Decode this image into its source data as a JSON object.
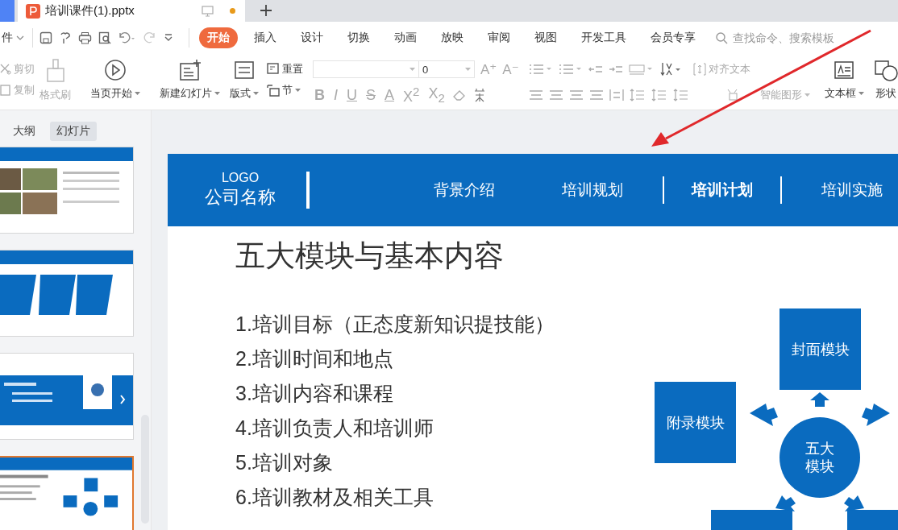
{
  "document_tab": {
    "title": "培训课件(1).pptx",
    "modified": true
  },
  "quick_access": {
    "file_menu": "件"
  },
  "menu_tabs": [
    {
      "label": "开始",
      "selected": true
    },
    {
      "label": "插入",
      "selected": false
    },
    {
      "label": "设计",
      "selected": false
    },
    {
      "label": "切换",
      "selected": false
    },
    {
      "label": "动画",
      "selected": false
    },
    {
      "label": "放映",
      "selected": false
    },
    {
      "label": "审阅",
      "selected": false
    },
    {
      "label": "视图",
      "selected": false
    },
    {
      "label": "开发工具",
      "selected": false
    },
    {
      "label": "会员专享",
      "selected": false
    }
  ],
  "search": {
    "placeholder": "查找命令、搜索模板"
  },
  "ribbon": {
    "cut": {
      "label": "剪切",
      "disabled": true
    },
    "copy": {
      "label": "复制",
      "disabled": true
    },
    "format_painter": {
      "label": "格式刷",
      "disabled": true
    },
    "play_from_current": "当页开始",
    "new_slide": "新建幻灯片",
    "layout": "版式",
    "reset": "重置",
    "section": "节",
    "font_size": "0",
    "font_grow": "A⁺",
    "font_shrink": "A⁻",
    "format_buttons": [
      "B",
      "I",
      "U",
      "S",
      "A",
      "X$^{2}$",
      "X$_{2}$"
    ],
    "align_text": {
      "label": "对齐文本",
      "disabled": true
    },
    "smart_art": {
      "label": "智能图形",
      "disabled": true
    },
    "text_box": "文本框",
    "shapes": "形状"
  },
  "panel": {
    "tabs": [
      {
        "label": "大纲",
        "selected": false
      },
      {
        "label": "幻灯片",
        "selected": true
      }
    ],
    "thumbnails": [
      {
        "kind": "photos",
        "selected": false
      },
      {
        "kind": "chevrons",
        "selected": false
      },
      {
        "kind": "section",
        "selected": false
      },
      {
        "kind": "modules",
        "selected": true
      }
    ]
  },
  "slide": {
    "logo": "LOGO",
    "company": "公司名称",
    "nav": [
      {
        "label": "背景介绍",
        "selected": false
      },
      {
        "label": "培训规划",
        "selected": false
      },
      {
        "label": "培训计划",
        "selected": true
      },
      {
        "label": "培训实施",
        "selected": false
      }
    ],
    "title": "五大模块与基本内容",
    "items": [
      "1.培训目标（正态度新知识提技能）",
      "2.培训时间和地点",
      "3.培训内容和课程",
      "4.培训负责人和培训师",
      "5.培训对象",
      "6.培训教材及相关工具"
    ],
    "diagram": {
      "center_lines": [
        "五大",
        "模块"
      ],
      "modules": [
        {
          "label": "封面模块"
        },
        {
          "label": "附录模块"
        }
      ]
    }
  }
}
